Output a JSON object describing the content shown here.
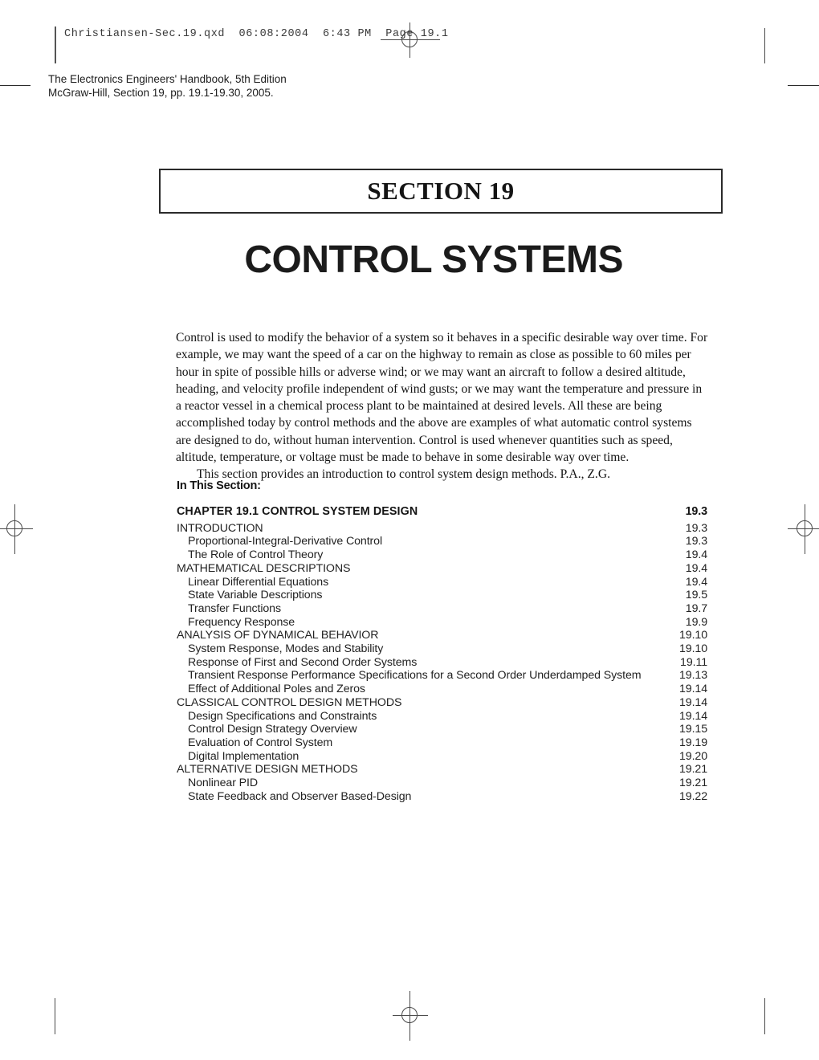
{
  "printer_header": {
    "text": "Christiansen-Sec.19.qxd  06:08:2004  6:43 PM  Page 19.1"
  },
  "publication": {
    "line1": "The Electronics Engineers' Handbook, 5th Edition",
    "line2": "McGraw-Hill, Section 19, pp. 19.1-19.30, 2005."
  },
  "section_box": {
    "label": "SECTION 19"
  },
  "title": "CONTROL SYSTEMS",
  "intro": {
    "paragraph1": "Control is used to modify the behavior of a system so it behaves in a specific desirable way over time. For example, we may want the speed of a car on the highway to remain as close as possible to 60 miles per hour in spite of possible hills or adverse wind; or we may want an aircraft to follow a desired altitude, heading, and velocity profile independent of wind gusts; or we may want the temperature and pressure in a reactor vessel in a chemical process plant to be maintained at desired levels. All these are being accomplished today by control methods and the above are examples of what automatic control systems are designed to do, without human intervention. Control is used whenever quantities such as speed, altitude, temperature, or voltage must be made to behave in some desirable way over time.",
    "paragraph2": "This section provides an introduction to control system design methods.    P.A., Z.G."
  },
  "in_this_section_label": "In This Section:",
  "toc": {
    "entries": [
      {
        "level": "chapter",
        "title": "CHAPTER 19.1   CONTROL SYSTEM DESIGN",
        "page": "19.3"
      },
      {
        "level": "level1",
        "title": "INTRODUCTION",
        "page": "19.3"
      },
      {
        "level": "level2",
        "title": "Proportional-Integral-Derivative Control",
        "page": "19.3"
      },
      {
        "level": "level2",
        "title": "The Role of Control Theory",
        "page": "19.4"
      },
      {
        "level": "level1",
        "title": "MATHEMATICAL DESCRIPTIONS",
        "page": "19.4"
      },
      {
        "level": "level2",
        "title": "Linear Differential Equations",
        "page": "19.4"
      },
      {
        "level": "level2",
        "title": "State Variable Descriptions",
        "page": "19.5"
      },
      {
        "level": "level2",
        "title": "Transfer Functions",
        "page": "19.7"
      },
      {
        "level": "level2",
        "title": "Frequency Response",
        "page": "19.9"
      },
      {
        "level": "level1",
        "title": "ANALYSIS OF DYNAMICAL BEHAVIOR",
        "page": "19.10"
      },
      {
        "level": "level2",
        "title": "System Response, Modes and Stability",
        "page": "19.10"
      },
      {
        "level": "level2",
        "title": "Response of First and Second Order Systems",
        "page": "19.11"
      },
      {
        "level": "level2",
        "title": "Transient Response Performance Specifications for a Second Order Underdamped System",
        "page": "19.13"
      },
      {
        "level": "level2",
        "title": "Effect of Additional Poles and Zeros",
        "page": "19.14"
      },
      {
        "level": "level1",
        "title": "CLASSICAL CONTROL DESIGN METHODS",
        "page": "19.14"
      },
      {
        "level": "level2",
        "title": "Design Specifications and Constraints",
        "page": "19.14"
      },
      {
        "level": "level2",
        "title": "Control Design Strategy Overview",
        "page": "19.15"
      },
      {
        "level": "level2",
        "title": "Evaluation of Control System",
        "page": "19.19"
      },
      {
        "level": "level2",
        "title": "Digital Implementation",
        "page": "19.20"
      },
      {
        "level": "level1",
        "title": "ALTERNATIVE DESIGN METHODS",
        "page": "19.21"
      },
      {
        "level": "level2",
        "title": "Nonlinear PID",
        "page": "19.21"
      },
      {
        "level": "level2",
        "title": "State Feedback and Observer Based-Design",
        "page": "19.22"
      }
    ]
  },
  "colors": {
    "text": "#1a1a1a",
    "rule": "#2a2a2a",
    "mark": "#4a4a4a"
  }
}
